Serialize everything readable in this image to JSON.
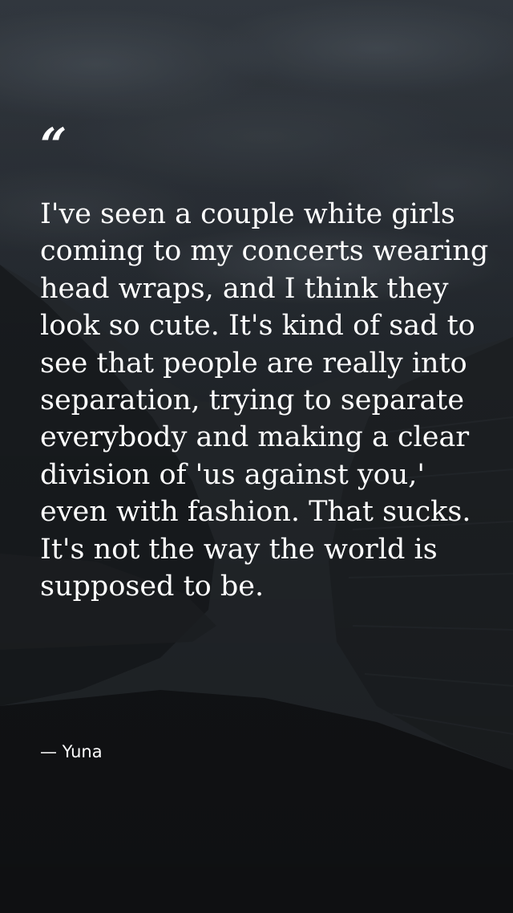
{
  "quote": {
    "mark": "“",
    "text": "I've seen a couple white girls coming to my concerts wearing head wraps, and I think they look so cute. It's kind of sad to see that people are really into separation, trying to separate everybody and making a clear division of 'us against you,' even with fashion. That sucks. It's not the way the world is supposed to be.",
    "author": "— Yuna"
  },
  "colors": {
    "text": "#ffffff",
    "sky_top": "#3a4149",
    "ground": "#17191c"
  }
}
